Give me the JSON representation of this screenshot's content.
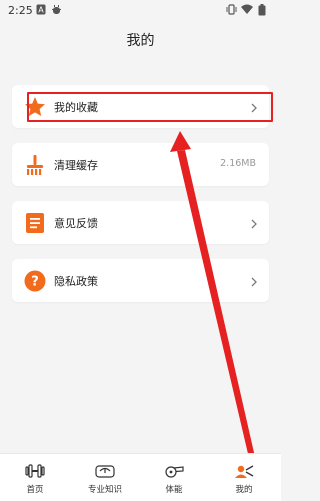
{
  "status_bar": {
    "time": "2:25",
    "icons": [
      "font-a-icon",
      "bug-icon",
      "vibrate-icon",
      "wifi-icon",
      "battery-icon"
    ]
  },
  "header": {
    "title": "我的"
  },
  "menu": [
    {
      "label": "我的收藏",
      "icon": "star-icon",
      "trailing": "chevron",
      "value": ""
    },
    {
      "label": "清理缓存",
      "icon": "broom-icon",
      "trailing": "value",
      "value": "2.16MB"
    },
    {
      "label": "意见反馈",
      "icon": "feedback-doc-icon",
      "trailing": "chevron",
      "value": ""
    },
    {
      "label": "隐私政策",
      "icon": "question-icon",
      "trailing": "chevron",
      "value": ""
    }
  ],
  "tabs": [
    {
      "label": "首页",
      "icon": "dumbbell-icon"
    },
    {
      "label": "专业知识",
      "icon": "scale-icon"
    },
    {
      "label": "体能",
      "icon": "whistle-icon"
    },
    {
      "label": "我的",
      "icon": "profile-icon",
      "active": true
    }
  ],
  "colors": {
    "accent": "#f26b1d",
    "annotation": "#e52121",
    "background": "#f4f4f4"
  }
}
